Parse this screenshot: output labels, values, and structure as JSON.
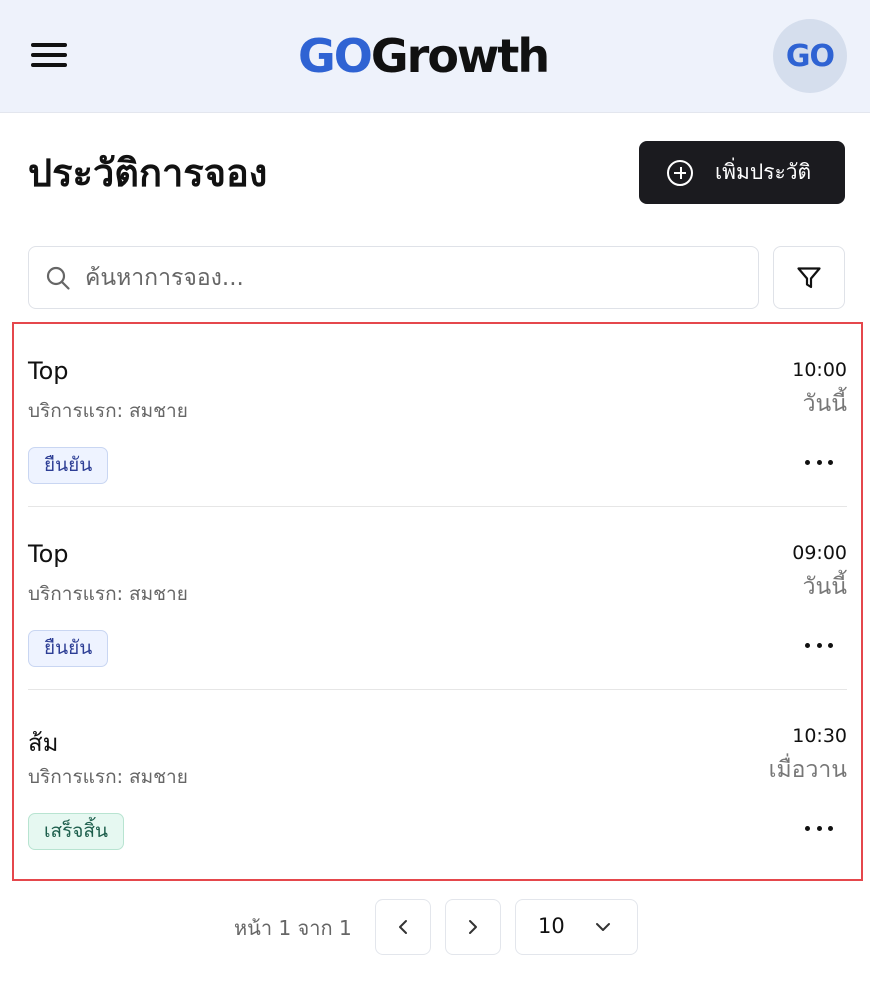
{
  "header": {
    "logo_go": "GO",
    "logo_growth": "Growth",
    "avatar_text": "GO"
  },
  "page": {
    "title": "ประวัติการจอง",
    "add_button_label": "เพิ่มประวัติ"
  },
  "search": {
    "placeholder": "ค้นหาการจอง...",
    "value": ""
  },
  "bookings": [
    {
      "name": "Top",
      "service": "บริการแรก: สมชาย",
      "time": "10:00",
      "day": "วันนี้",
      "status": "ยืนยัน"
    },
    {
      "name": "Top",
      "service": "บริการแรก: สมชาย",
      "time": "09:00",
      "day": "วันนี้",
      "status": "ยืนยัน"
    },
    {
      "name": "ส้ม",
      "service": "บริการแรก: สมชาย",
      "time": "10:30",
      "day": "เมื่อวาน",
      "status": "เสร็จสิ้น"
    }
  ],
  "pagination": {
    "info": "หน้า 1 จาก 1",
    "page_size": "10"
  },
  "colors": {
    "brand_blue": "#2f63d3",
    "header_bg": "#eef2fb",
    "primary_button": "#1b1b1f",
    "highlight_border": "#e5474c",
    "badge_confirmed_bg": "#eef3ff",
    "badge_done_bg": "#e6f8f1"
  },
  "icons": [
    "menu-icon",
    "search-icon",
    "filter-icon",
    "plus-circle-icon",
    "more-horizontal-icon",
    "chevron-left-icon",
    "chevron-right-icon",
    "chevron-down-icon"
  ]
}
